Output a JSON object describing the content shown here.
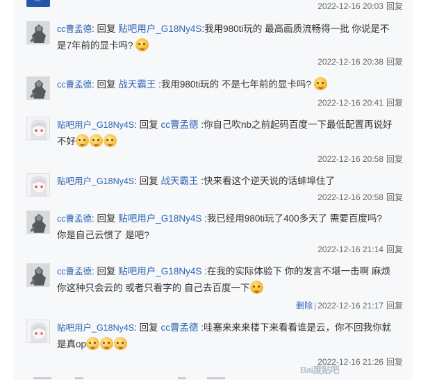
{
  "top": {
    "timestamp": "2022-12-16 20:03",
    "reply_label": "回复"
  },
  "replies": [
    {
      "author": "cc曹孟德",
      "verb": "回复",
      "target": "贴吧用户_G18Ny4S",
      "text_line1": ":我用980ti玩的 最高画质流畅得一批 你说是不",
      "text_line2": "是7年前的显卡吗?",
      "emoji": "emoticon-face",
      "timestamp": "2022-12-16 20:38",
      "reply_label": "回复"
    },
    {
      "author": "cc曹孟德",
      "verb": "回复",
      "target": "战天霸王",
      "text_line1": ":我用980ti玩的 不是七年前的显卡吗?",
      "emoji": "emoticon-face",
      "timestamp": "2022-12-16 20:41",
      "reply_label": "回复"
    },
    {
      "author": "贴吧用户_G18Ny4S",
      "verb": "回复",
      "target": "cc曹孟德",
      "text_line1": ":你自己吹nb之前起码百度一下最低配置再说好",
      "text_line2": "不好",
      "emoji_count": 3,
      "timestamp": "2022-12-16 20:58",
      "reply_label": "回复"
    },
    {
      "author": "贴吧用户_G18Ny4S",
      "verb": "回复",
      "target": "战天霸王",
      "text_line1": ":快来看这个逆天说的话蚌埠住了",
      "timestamp": "2022-12-16 20:58",
      "reply_label": "回复"
    },
    {
      "author": "cc曹孟德",
      "verb": "回复",
      "target": "贴吧用户_G18Ny4S",
      "text_line1": ":我已经用980ti玩了400多天了 需要百度吗?",
      "text_line2": "你是自己云惯了 是吧?",
      "timestamp": "2022-12-16 21:14",
      "reply_label": "回复"
    },
    {
      "author": "cc曹孟德",
      "verb": "回复",
      "target": "贴吧用户_G18Ny4S",
      "text_line1": ":在我的实际体验下 你的发言不堪一击啊 麻烦",
      "text_line2": "你这种只会云的 或者只看字的 自己去百度一下",
      "emoji": "emoticon-face",
      "delete_label": "删除",
      "separator": "|",
      "timestamp": "2022-12-16 21:17",
      "reply_label": "回复"
    },
    {
      "author": "贴吧用户_G18Ny4S",
      "verb": "回复",
      "target": "cc曹孟德",
      "text_line1": ":哇塞来来来楼下来看看谁是云，你不回我你就",
      "text_line2": "是真op",
      "emoji_count": 3,
      "timestamp": "2022-12-16 21:26",
      "reply_label": "回复"
    }
  ],
  "watermark": "Bai度贴吧"
}
